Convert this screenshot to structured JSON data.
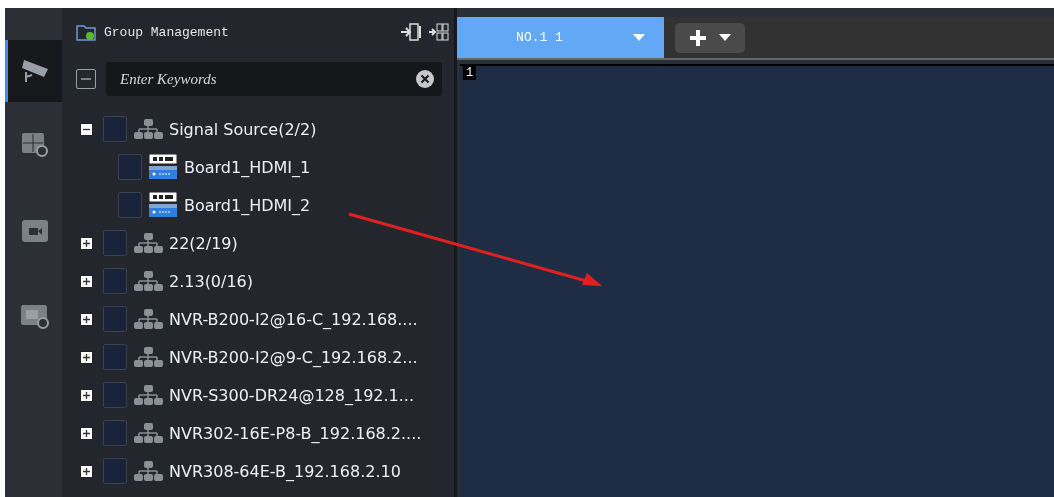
{
  "rail": [
    {
      "kind": "camera",
      "selected": true
    },
    {
      "kind": "wall",
      "selected": false
    },
    {
      "kind": "record",
      "selected": false
    },
    {
      "kind": "screen",
      "selected": false
    }
  ],
  "panel": {
    "title": "Group Management",
    "search": {
      "placeholder": "Enter Keywords"
    },
    "tree": [
      {
        "label": "Signal Source(2/2)",
        "kind": "group",
        "expanded": true,
        "checked": false,
        "children": [
          {
            "label": "Board1_HDMI_1",
            "kind": "hdmi",
            "checked": false
          },
          {
            "label": "Board1_HDMI_2",
            "kind": "hdmi",
            "checked": false
          }
        ]
      },
      {
        "label": "22(2/19)",
        "kind": "group",
        "expanded": false,
        "checked": false
      },
      {
        "label": "2.13(0/16)",
        "kind": "group",
        "expanded": false,
        "checked": false
      },
      {
        "label": "NVR-B200-I2@16-C_192.168....",
        "kind": "group",
        "expanded": false,
        "checked": false
      },
      {
        "label": "NVR-B200-I2@9-C_192.168.2...",
        "kind": "group",
        "expanded": false,
        "checked": false
      },
      {
        "label": "NVR-S300-DR24@128_192.1...",
        "kind": "group",
        "expanded": false,
        "checked": false
      },
      {
        "label": "NVR302-16E-P8-B_192.168.2....",
        "kind": "group",
        "expanded": false,
        "checked": false
      },
      {
        "label": "NVR308-64E-B_192.168.2.10",
        "kind": "group",
        "expanded": false,
        "checked": false
      }
    ]
  },
  "tabs": [
    {
      "label": "NO.1 1",
      "selected": true
    }
  ],
  "screen": {
    "window_number": "1"
  }
}
